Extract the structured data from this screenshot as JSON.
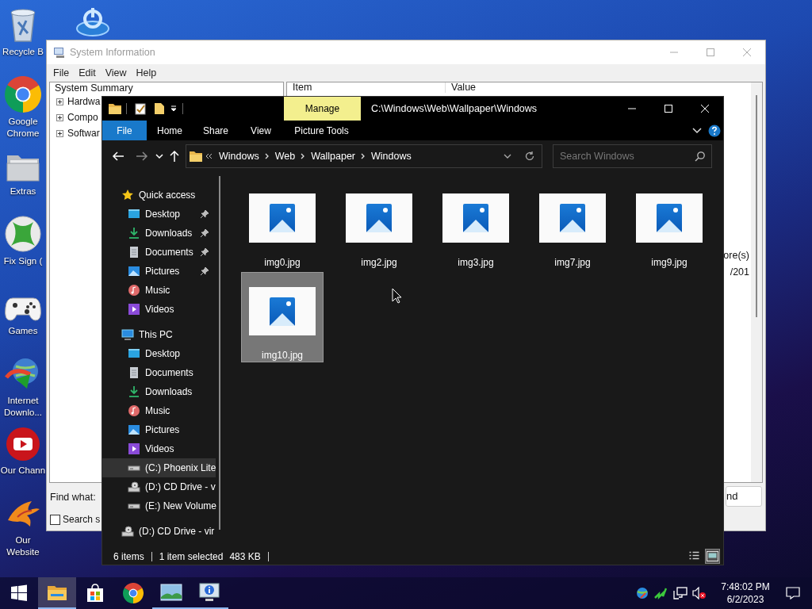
{
  "desktop": {
    "icons": [
      {
        "kind": "recycle",
        "label": "Recycle B"
      },
      {
        "kind": "chrome",
        "label": "Google Chrome"
      },
      {
        "kind": "folder",
        "label": "Extras"
      },
      {
        "kind": "xbox",
        "label": "Fix Sign ("
      },
      {
        "kind": "gamepad",
        "label": "Games"
      },
      {
        "kind": "idm",
        "label": "Internet Downlo..."
      },
      {
        "kind": "youtube",
        "label": "Our Chann"
      },
      {
        "kind": "bird",
        "label": "Our Website"
      }
    ]
  },
  "system_information": {
    "title": "System Information",
    "menu": [
      "File",
      "Edit",
      "View",
      "Help"
    ],
    "tree": {
      "label": "System Summary",
      "children": [
        {
          "label": "Hardwa",
          "expanded": false
        },
        {
          "label": "Compo",
          "expanded": false
        },
        {
          "label": "Softwar",
          "expanded": false
        }
      ]
    },
    "columns": [
      "Item",
      "Value"
    ],
    "value_fragments": [
      "ore(s)",
      "/201"
    ],
    "find_label": "Find what:",
    "search_option": {
      "label": "Search s",
      "checked": false
    },
    "find_button": "nd"
  },
  "explorer": {
    "context_tab": "Manage",
    "title": "C:\\Windows\\Web\\Wallpaper\\Windows",
    "ribbon_tabs": [
      {
        "label": "File",
        "kind": "file"
      },
      {
        "label": "Home",
        "kind": "tab"
      },
      {
        "label": "Share",
        "kind": "tab"
      },
      {
        "label": "View",
        "kind": "tab"
      },
      {
        "label": "Picture Tools",
        "kind": "tab"
      }
    ],
    "breadcrumbs": [
      "Windows",
      "Web",
      "Wallpaper",
      "Windows"
    ],
    "search_placeholder": "Search Windows",
    "nav": [
      {
        "label": "Quick access",
        "kind": "star",
        "selected": false,
        "children": [
          {
            "label": "Desktop",
            "kind": "desktop",
            "pinned": true,
            "selected": false
          },
          {
            "label": "Downloads",
            "kind": "download",
            "pinned": true,
            "selected": false
          },
          {
            "label": "Documents",
            "kind": "document",
            "pinned": true,
            "selected": false
          },
          {
            "label": "Pictures",
            "kind": "pictures",
            "pinned": true,
            "selected": false
          },
          {
            "label": "Music",
            "kind": "music",
            "pinned": false,
            "selected": false
          },
          {
            "label": "Videos",
            "kind": "videos",
            "pinned": false,
            "selected": false
          }
        ]
      },
      {
        "label": "This PC",
        "kind": "pc",
        "selected": false,
        "children": [
          {
            "label": "Desktop",
            "kind": "desktop",
            "pinned": false,
            "selected": false
          },
          {
            "label": "Documents",
            "kind": "document",
            "pinned": false,
            "selected": false
          },
          {
            "label": "Downloads",
            "kind": "download",
            "pinned": false,
            "selected": false
          },
          {
            "label": "Music",
            "kind": "music",
            "pinned": false,
            "selected": false
          },
          {
            "label": "Pictures",
            "kind": "pictures",
            "pinned": false,
            "selected": false
          },
          {
            "label": "Videos",
            "kind": "videos",
            "pinned": false,
            "selected": false
          },
          {
            "label": "(C:) Phoenix Lite",
            "kind": "drive",
            "pinned": false,
            "selected": true
          },
          {
            "label": "(D:) CD Drive - v",
            "kind": "cd",
            "pinned": false,
            "selected": false
          },
          {
            "label": "(E:) New Volume",
            "kind": "drive",
            "pinned": false,
            "selected": false
          }
        ]
      },
      {
        "label": "(D:) CD Drive - vir",
        "kind": "cd",
        "selected": false
      }
    ],
    "files": [
      {
        "name": "img0.jpg",
        "selected": false
      },
      {
        "name": "img2.jpg",
        "selected": false
      },
      {
        "name": "img3.jpg",
        "selected": false
      },
      {
        "name": "img7.jpg",
        "selected": false
      },
      {
        "name": "img9.jpg",
        "selected": false
      },
      {
        "name": "img10.jpg",
        "selected": true
      }
    ],
    "status": {
      "count": "6 items",
      "selection": "1 item selected",
      "size": "483 KB"
    },
    "views": [
      {
        "kind": "details",
        "selected": false
      },
      {
        "kind": "large-icons",
        "selected": true
      }
    ]
  },
  "taskbar": {
    "apps": [
      {
        "kind": "start",
        "running": false,
        "active": false
      },
      {
        "kind": "explorer",
        "running": true,
        "active": true
      },
      {
        "kind": "store",
        "running": false,
        "active": false
      },
      {
        "kind": "chrome",
        "running": false,
        "active": false
      },
      {
        "kind": "photos",
        "running": true,
        "active": false
      },
      {
        "kind": "sysinfo",
        "running": true,
        "active": false
      }
    ],
    "time": "7:48:02 PM",
    "date": "6/2/2023"
  }
}
